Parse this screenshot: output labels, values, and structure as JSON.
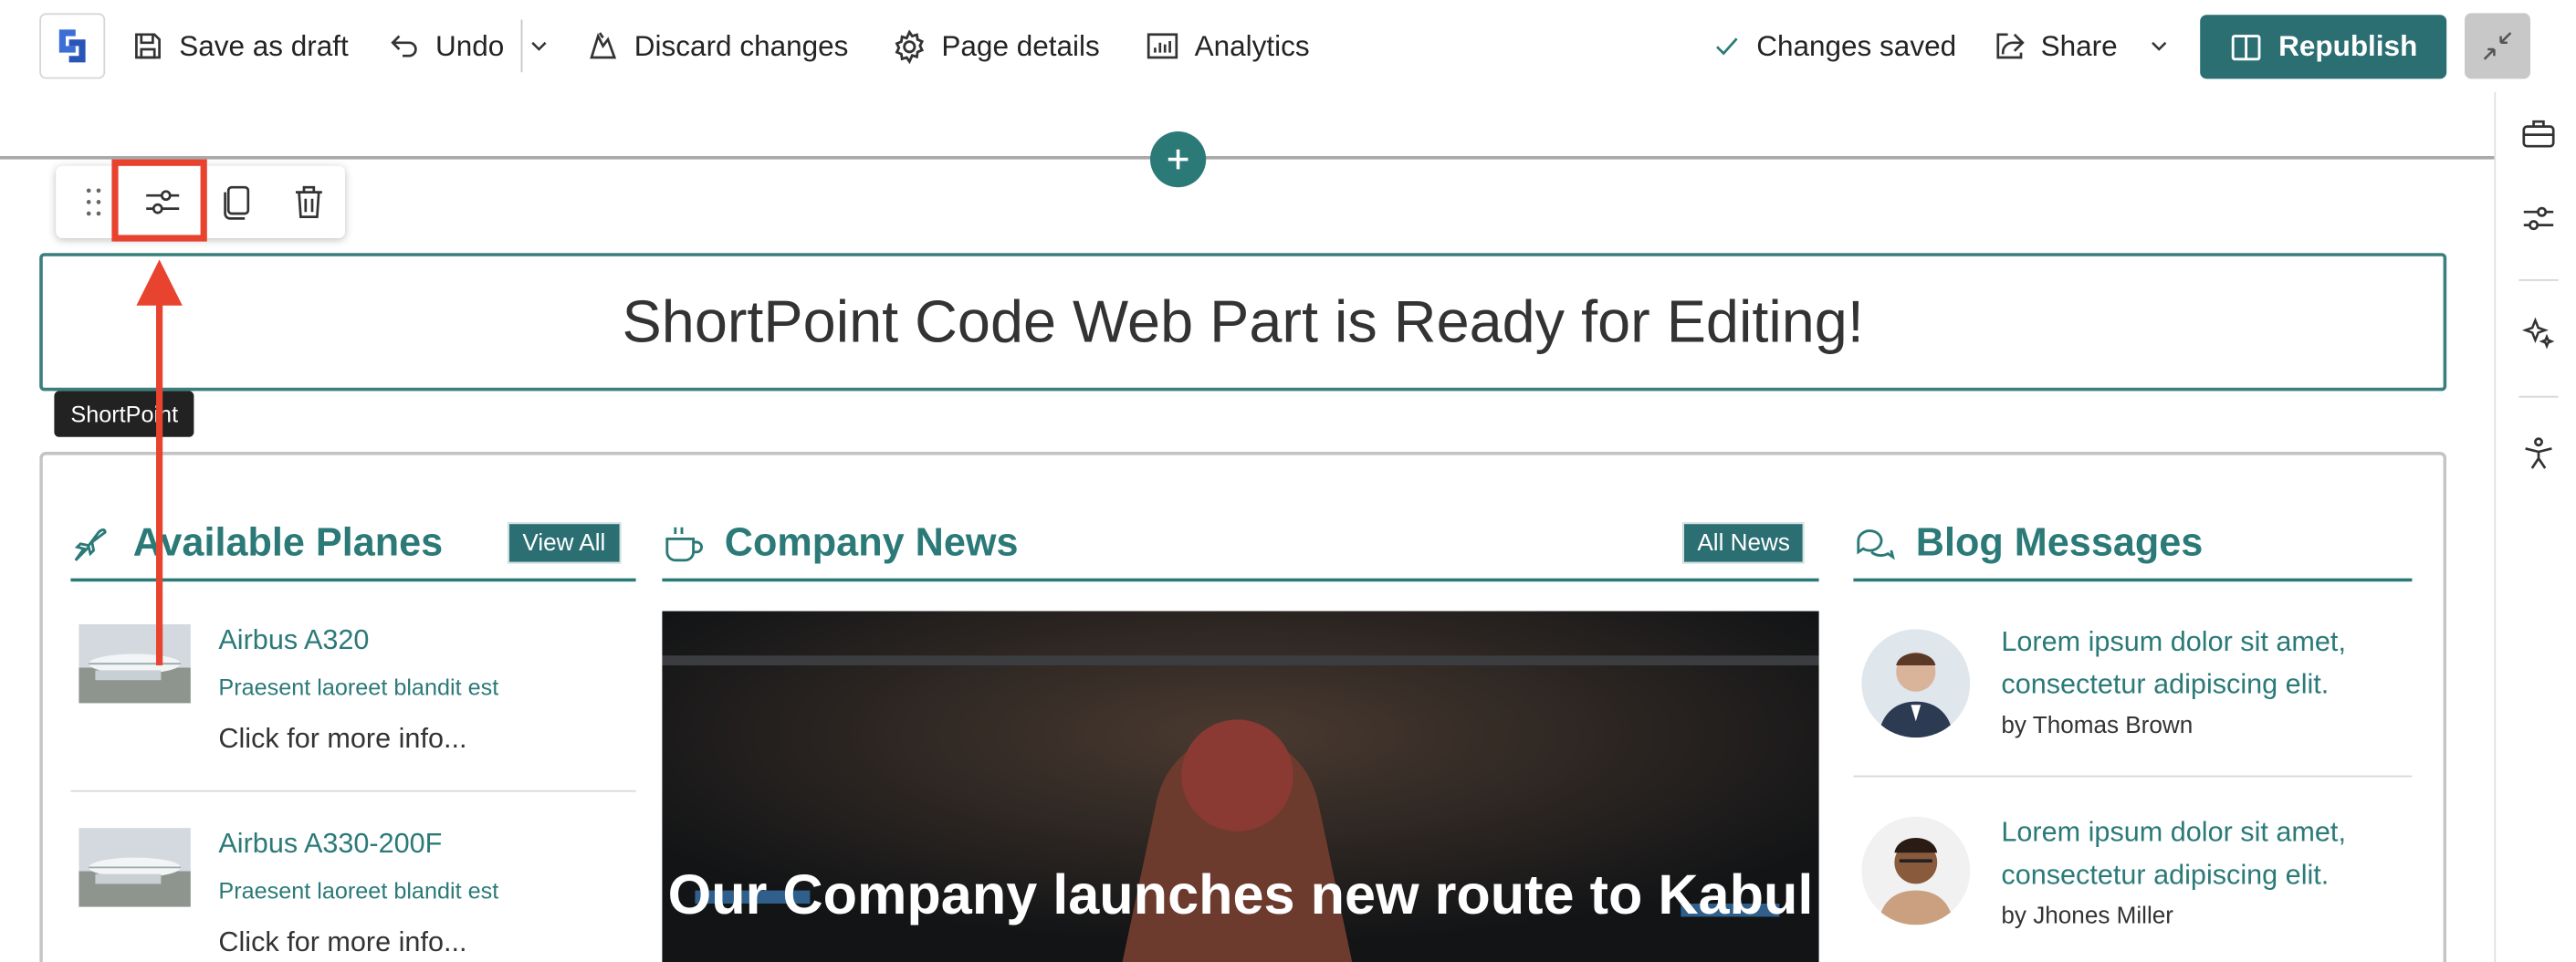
{
  "command_bar": {
    "save_draft": "Save as draft",
    "undo": "Undo",
    "discard": "Discard changes",
    "page_details": "Page details",
    "analytics": "Analytics",
    "status": "Changes saved",
    "share": "Share",
    "republish": "Republish"
  },
  "tooltip": "ShortPoint",
  "webpart_message": "ShortPoint Code Web Part is Ready for Editing!",
  "columns": {
    "planes": {
      "title": "Available Planes",
      "button": "View All"
    },
    "news": {
      "title": "Company News",
      "button": "All News"
    },
    "blog": {
      "title": "Blog Messages"
    }
  },
  "planes": [
    {
      "name": "Airbus A320",
      "subtitle": "Praesent laoreet blandit est",
      "more": "Click for more info..."
    },
    {
      "name": "Airbus A330-200F",
      "subtitle": "Praesent laoreet blandit est",
      "more": "Click for more info..."
    }
  ],
  "news": {
    "headline": "Our Company launches new route to Kabul"
  },
  "blog": [
    {
      "text": "Lorem ipsum dolor sit amet, consectetur adipiscing elit.",
      "author": "by Thomas Brown"
    },
    {
      "text": "Lorem ipsum dolor sit amet, consectetur adipiscing elit.",
      "author": "by Jhones Miller"
    }
  ],
  "colors": {
    "accent": "#2b7a78",
    "republish": "#2b6f73",
    "highlight": "#e8432e"
  }
}
